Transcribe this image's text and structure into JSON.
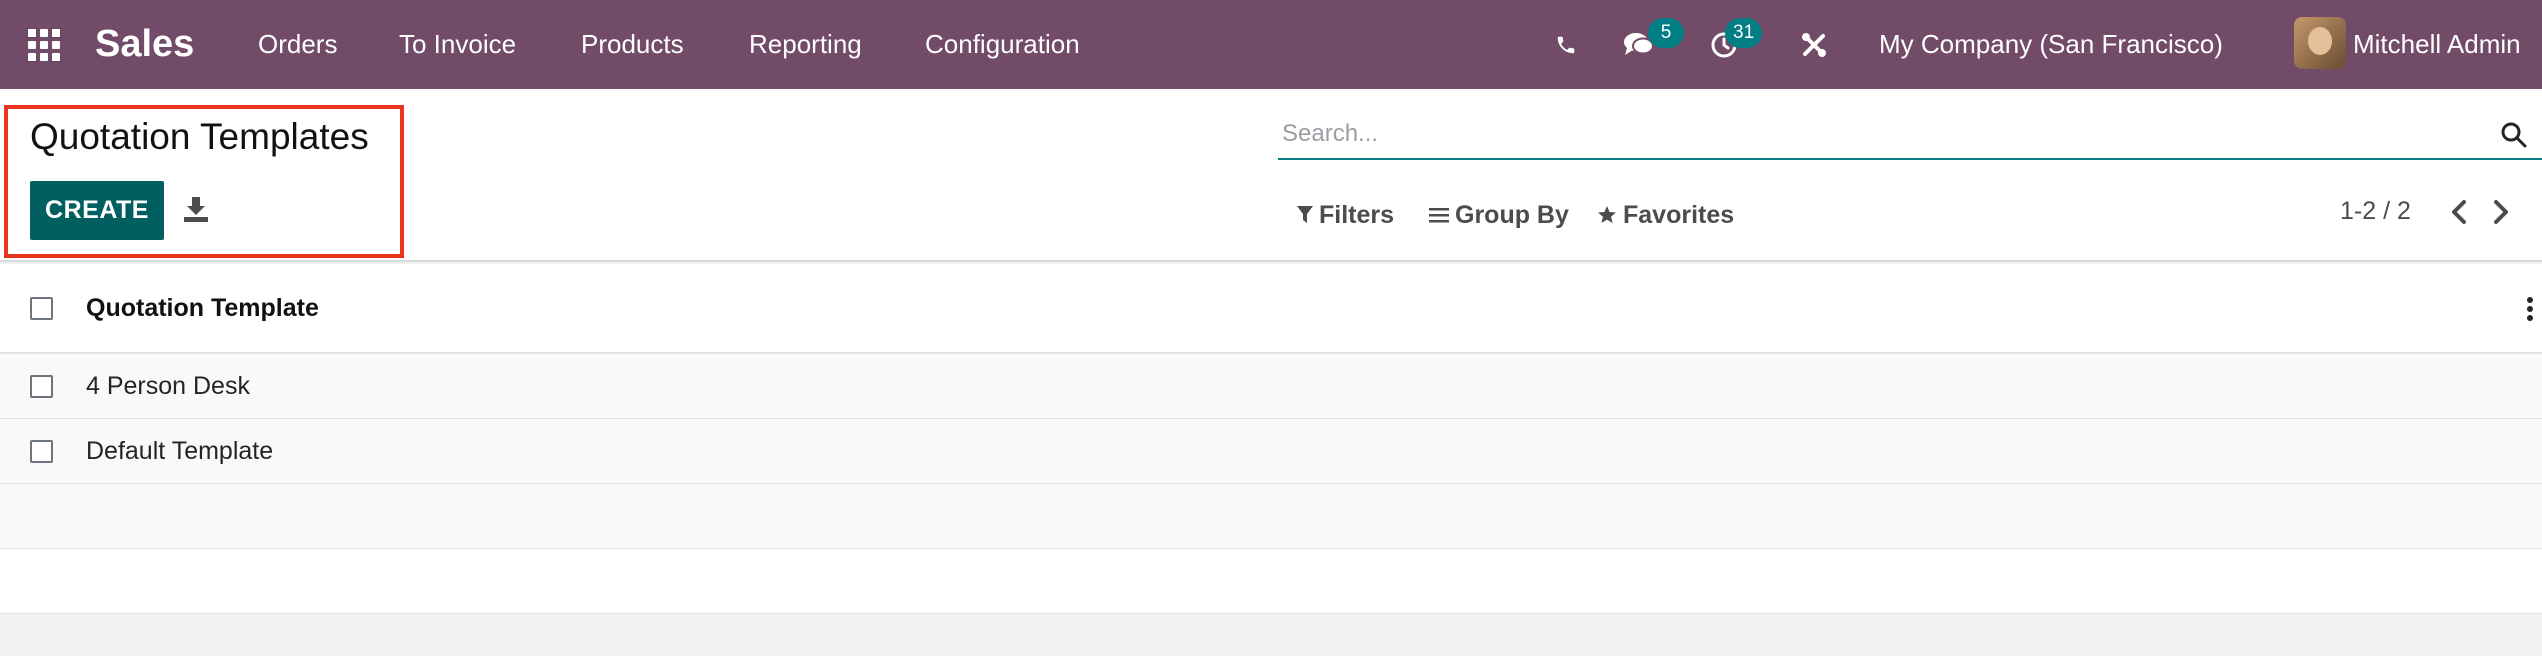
{
  "topbar": {
    "app_name": "Sales",
    "menu": [
      "Orders",
      "To Invoice",
      "Products",
      "Reporting",
      "Configuration"
    ],
    "messages_count": "5",
    "activities_count": "31",
    "company": "My Company (San Francisco)",
    "user_name": "Mitchell Admin",
    "icons": [
      "apps-icon",
      "phone-icon",
      "chat-icon",
      "activity-icon",
      "tools-icon"
    ]
  },
  "control": {
    "title": "Quotation Templates",
    "create_label": "CREATE",
    "search_placeholder": "Search...",
    "filters_label": "Filters",
    "groupby_label": "Group By",
    "favorites_label": "Favorites",
    "pager": "1-2 / 2"
  },
  "list": {
    "column_header": "Quotation Template",
    "rows": [
      "4 Person Desk",
      "Default Template"
    ]
  },
  "colors": {
    "topbar": "#714b67",
    "primary_button": "#015f5f",
    "accent": "#017e84",
    "highlight": "#e8331e"
  }
}
